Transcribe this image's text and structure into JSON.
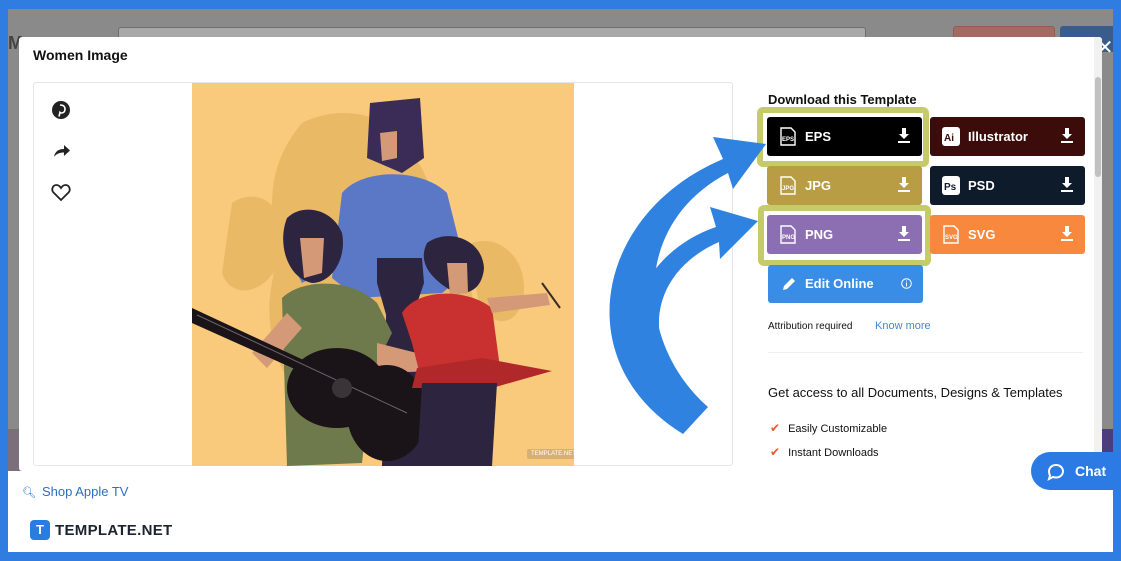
{
  "modal": {
    "title": "Women Image",
    "close_label": "✕"
  },
  "social": [
    "pinterest-icon",
    "share-icon",
    "heart-icon"
  ],
  "artwork": {
    "watermark": "TEMPLATE.NET"
  },
  "download": {
    "title": "Download this Template",
    "buttons": [
      {
        "label": "EPS",
        "color": "#000000",
        "icon": "eps-file-icon",
        "highlighted": true
      },
      {
        "label": "Illustrator",
        "color": "#3b0c0a",
        "icon": "illustrator-icon",
        "highlighted": false
      },
      {
        "label": "JPG",
        "color": "#b89d44",
        "icon": "jpg-file-icon",
        "highlighted": false
      },
      {
        "label": "PSD",
        "color": "#0d1b2b",
        "icon": "photoshop-icon",
        "highlighted": false
      },
      {
        "label": "PNG",
        "color": "#8c6fb2",
        "icon": "png-file-icon",
        "highlighted": true
      },
      {
        "label": "SVG",
        "color": "#f7883d",
        "icon": "svg-file-icon",
        "highlighted": false
      }
    ],
    "edit_online": "Edit Online",
    "attribution": "Attribution required",
    "know_more": "Know more"
  },
  "access": {
    "title": "Get access to all Documents, Designs & Templates",
    "features": [
      "Easily Customizable",
      "Instant Downloads"
    ]
  },
  "footer": {
    "shop_link": "Shop Apple TV",
    "logo_mark": "T",
    "logo_text": "TEMPLATE.NET"
  },
  "chat": {
    "label": "Chat"
  },
  "colors": {
    "frame_blue": "#2f7de0",
    "highlight": "#c6cb6a",
    "arrow_blue": "#2f82e0"
  }
}
